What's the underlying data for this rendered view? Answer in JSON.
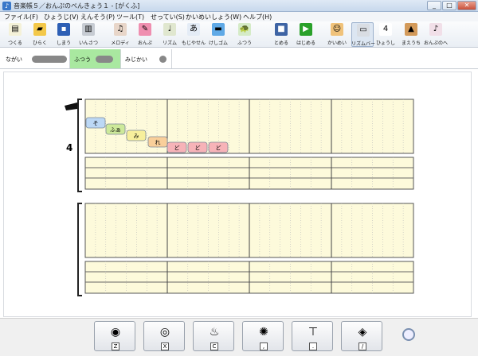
{
  "window": {
    "title": "音楽帳５／おんぷのべんきょう１ - [がくふ]",
    "buttons": [
      "_",
      "□",
      "✕"
    ]
  },
  "menu": [
    "ファイル(F)",
    "ひょうじ(V)",
    "えんそう(P)",
    "ツール(T)",
    "せってい(S)",
    "かいめいしょう(W)",
    "ヘルプ(H)"
  ],
  "toolbar": [
    {
      "label": "つくる",
      "icon": "new-document-icon",
      "color": "#f4f1d8",
      "glyph": "▤"
    },
    {
      "label": "ひらく",
      "icon": "open-folder-icon",
      "color": "#f3c84a",
      "glyph": "▰"
    },
    {
      "label": "しまう",
      "icon": "save-disk-icon",
      "color": "#2d5fb5",
      "glyph": "▪"
    },
    {
      "label": "いんさつ",
      "icon": "printer-icon",
      "color": "#c7ccd3",
      "glyph": "▥"
    },
    {
      "label": "メロディ",
      "icon": "melody-icon",
      "color": "#e8d6c9",
      "glyph": "♫"
    },
    {
      "label": "おんぷ",
      "icon": "note-pencil-icon",
      "color": "#ef8fb0",
      "glyph": "✎"
    },
    {
      "label": "リズム",
      "icon": "rhythm-icon",
      "color": "#e0e7cf",
      "glyph": "♩"
    },
    {
      "label": "もじやせん",
      "icon": "text-line-icon",
      "color": "#e4ecf6",
      "glyph": "あ"
    },
    {
      "label": "けしゴム",
      "icon": "eraser-icon",
      "color": "#5fa9e6",
      "glyph": "▬"
    },
    {
      "label": "ふつう",
      "icon": "turtle-rabbit-icon",
      "color": "#d5ebc7",
      "glyph": "🐢"
    },
    {
      "label": "とめる",
      "icon": "stop-icon",
      "color": "#3e64a4",
      "glyph": "■"
    },
    {
      "label": "はじめる",
      "icon": "play-icon",
      "color": "#2aa12a",
      "glyph": "▶"
    },
    {
      "label": "かいめい",
      "icon": "lion-face-icon",
      "color": "#f0c27a",
      "glyph": "☺"
    },
    {
      "label": "リズムバー",
      "icon": "rhythm-bar-icon",
      "color": "#d9dde3",
      "glyph": "▭"
    },
    {
      "label": "ひょうし",
      "icon": "time-signature-icon",
      "color": "#ffffff",
      "glyph": "4"
    },
    {
      "label": "まえうち",
      "icon": "metronome-icon",
      "color": "#d39a5a",
      "glyph": "▲"
    },
    {
      "label": "おんぷのへ",
      "icon": "note-dance-icon",
      "color": "#f1dfe8",
      "glyph": "♪"
    }
  ],
  "tempo": [
    {
      "label": "ながい"
    },
    {
      "label": "ふつう"
    },
    {
      "label": "みじかい"
    }
  ],
  "score": {
    "time_signature": "4",
    "notes": [
      "そ",
      "ふぁ",
      "み",
      "れ",
      "ど",
      "ど",
      "ど"
    ]
  },
  "drums": [
    {
      "icon": "bass-drum-icon",
      "key": "Z"
    },
    {
      "icon": "snare-drum-icon",
      "key": "X"
    },
    {
      "icon": "drum-sticks-icon",
      "key": "C"
    },
    {
      "icon": "cymbals-icon",
      "key": ","
    },
    {
      "icon": "hi-hat-icon",
      "key": "."
    },
    {
      "icon": "tambourine-icon",
      "key": "/"
    }
  ],
  "colors": {
    "staff_fill": "#fdfadb",
    "note_blue": "#bcd8f5",
    "note_green": "#cde99a",
    "note_yellow": "#f7ef9c",
    "note_orange": "#f9cf9a",
    "note_red": "#f7b3b8",
    "tempo_selected": "#a9e8a0"
  }
}
